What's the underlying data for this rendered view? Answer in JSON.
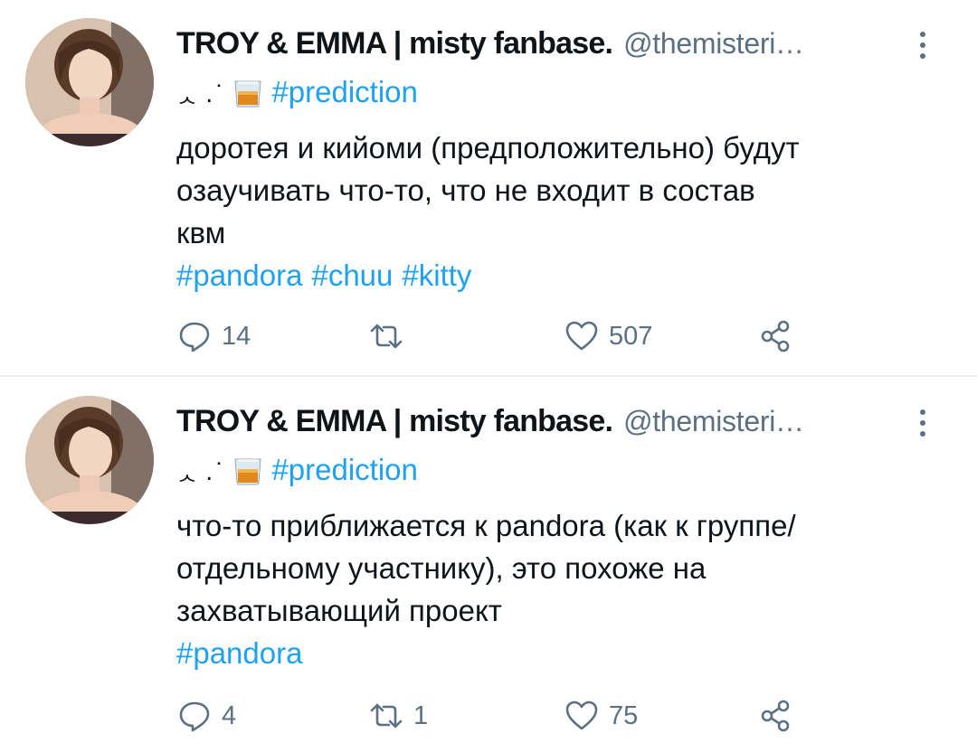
{
  "colors": {
    "link": "#1da1f2",
    "secondary_text": "#5b7083",
    "divider": "#e6ecf0"
  },
  "tweets": [
    {
      "author_name": "TROY & EMMA | misty fanbase.",
      "author_handle": "@themisteri…",
      "deco": "ᆺ .˙",
      "deco_emoji": "tumbler-glass-emoji",
      "label_hashtag": "#prediction",
      "text_lines": [
        "доротея и кийоми (предположительно) будут",
        "озаучивать что-то, что не входит в состав",
        "квм"
      ],
      "hashtags": [
        "#pandora",
        "#chuu",
        "#kitty"
      ],
      "reply_count": "14",
      "retweet_count": "",
      "like_count": "507",
      "icons": [
        "reply-icon",
        "retweet-icon",
        "like-icon",
        "share-icon",
        "more-icon"
      ]
    },
    {
      "author_name": "TROY & EMMA | misty fanbase.",
      "author_handle": "@themisteri…",
      "deco": "ᆺ .˙",
      "deco_emoji": "tumbler-glass-emoji",
      "label_hashtag": "#prediction",
      "text_lines": [
        "что-то приближается к pandora (как к группе/",
        "отдельному участнику), это похоже на",
        "захватывающий проект"
      ],
      "hashtags": [
        "#pandora"
      ],
      "reply_count": "4",
      "retweet_count": "1",
      "like_count": "75",
      "icons": [
        "reply-icon",
        "retweet-icon",
        "like-icon",
        "share-icon",
        "more-icon"
      ]
    }
  ]
}
